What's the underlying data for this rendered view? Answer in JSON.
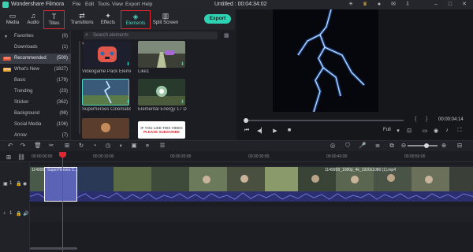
{
  "app": {
    "name": "Wondershare Filmora",
    "menu": [
      "File",
      "Edit",
      "Tools",
      "View",
      "Export",
      "Help"
    ],
    "document_title": "Untitled : 00:04:34:02"
  },
  "toolbar": {
    "tools": [
      {
        "label": "Media",
        "icon": "folder-icon"
      },
      {
        "label": "Audio",
        "icon": "music-icon"
      },
      {
        "label": "Titles",
        "icon": "text-icon"
      },
      {
        "label": "Transitions",
        "icon": "transition-icon"
      },
      {
        "label": "Effects",
        "icon": "effects-icon"
      },
      {
        "label": "Elements",
        "icon": "elements-icon"
      },
      {
        "label": "Split Screen",
        "icon": "split-screen-icon"
      }
    ],
    "export_label": "Export",
    "accent": "#2ed3b3",
    "highlight": "#e0262e"
  },
  "categories": [
    {
      "name": "Favorites",
      "count": "(0)",
      "caret": "▾"
    },
    {
      "name": "Downloads",
      "count": "(1)"
    },
    {
      "name": "Recommended",
      "count": "(500)",
      "tag": "HOT",
      "selected": true
    },
    {
      "name": "What's New",
      "count": "(1827)",
      "tag": "NEW"
    },
    {
      "name": "Basic",
      "count": "(179)"
    },
    {
      "name": "Trending",
      "count": "(23)"
    },
    {
      "name": "Sticker",
      "count": "(362)"
    },
    {
      "name": "Background",
      "count": "(98)"
    },
    {
      "name": "Social Media",
      "count": "(106)"
    },
    {
      "name": "Arrow",
      "count": "(7)"
    }
  ],
  "elements": {
    "search_placeholder": "Search elements",
    "items": [
      {
        "label": "Videogame Pack Eleme...",
        "colors": [
          "#1d1f2c",
          "#e2574c"
        ]
      },
      {
        "label": "Like1",
        "colors": [
          "#3b3f35",
          "#b8c29a"
        ]
      },
      {
        "label": "Superheroes Cinematic ...",
        "colors": [
          "#3a5a7a",
          "#7fb6e6"
        ]
      },
      {
        "label": "Elemental Energy 17 Da...",
        "colors": [
          "#283a2c",
          "#9fc6a8"
        ]
      },
      {
        "label": "",
        "colors": [
          "#5a3d2c",
          "#c48c5a"
        ]
      },
      {
        "label": "",
        "colors": [
          "#ffffff",
          "#f3f3f3"
        ],
        "text": [
          "IF YOU LIKE THIS VIDEO",
          "PLEASE SUBSCRIBE"
        ]
      }
    ]
  },
  "preview": {
    "timecode": "00:00:04:14",
    "quality": "Full",
    "bracket_in": "{",
    "bracket_out": "}",
    "progress": 0.0
  },
  "timeline": {
    "ruler": [
      "00:00:00:00",
      "00:00:10:00",
      "00:00:20:00",
      "00:00:30:00",
      "00:00:40:00",
      "00:00:50:00"
    ],
    "clip_titles": [
      "1149958_1080p...",
      "SuperHeroes C...",
      "1149958_1080p_4k_1920x1080 (1).mp4"
    ],
    "track_labels": [
      "1",
      "1"
    ]
  }
}
